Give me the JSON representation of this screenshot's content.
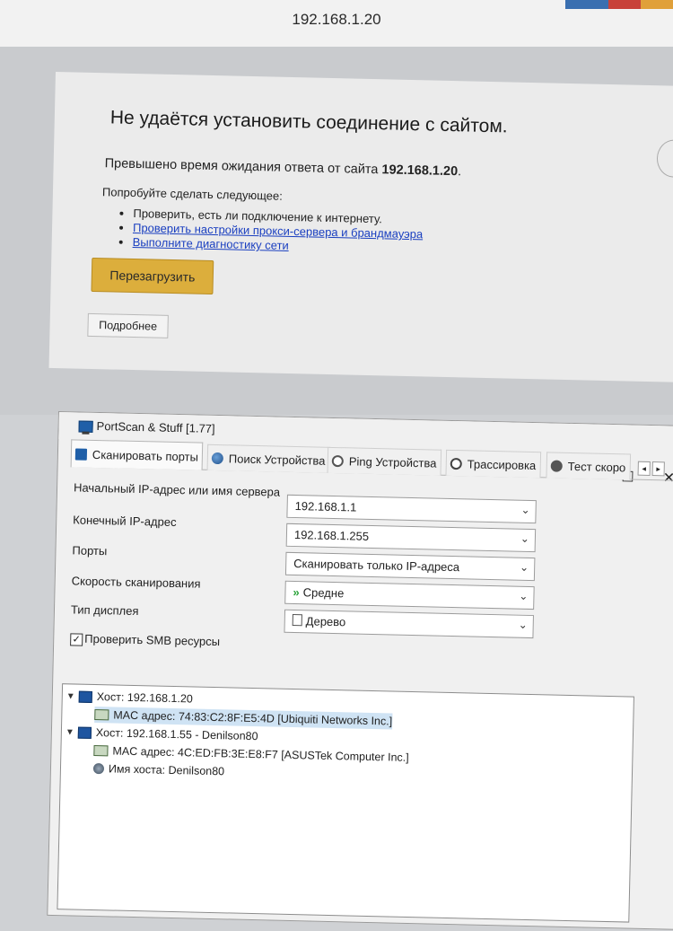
{
  "browser": {
    "url": "192.168.1.20"
  },
  "error_page": {
    "title": "Не удаётся установить соединение с сайтом.",
    "desc_prefix": "Превышено время ожидания ответа от сайта ",
    "desc_host": "192.168.1.20",
    "desc_suffix": ".",
    "try_text": "Попробуйте сделать следующее:",
    "suggestions": [
      "Проверить, есть ли подключение к интернету.",
      "Проверить настройки прокси-сервера и брандмауэра",
      "Выполните диагностику сети"
    ],
    "reload_label": "Перезагрузить",
    "details_label": "Подробнее"
  },
  "app": {
    "title": "PortScan & Stuff [1.77]",
    "minimize": "—",
    "maximize": "☐",
    "close": "✕",
    "tabs": [
      {
        "label": "Сканировать порты",
        "icon": "monitor-icon"
      },
      {
        "label": "Поиск Устройства",
        "icon": "globe-icon"
      },
      {
        "label": "Ping Устройства",
        "icon": "ping-icon"
      },
      {
        "label": "Трассировка",
        "icon": "trace-icon"
      },
      {
        "label": "Тест скоро",
        "icon": "speedtest-icon"
      }
    ],
    "tab_scroll_left": "◂",
    "tab_scroll_right": "▸",
    "form": {
      "start_ip_label": "Начальный IP-адрес или имя сервера",
      "start_ip_value": "192.168.1.1",
      "end_ip_label": "Конечный IP-адрес",
      "end_ip_value": "192.168.1.255",
      "ports_label": "Порты",
      "ports_value": "Сканировать только IP-адреса",
      "speed_label": "Скорость сканирования",
      "speed_value": "Средне",
      "display_label": "Тип дисплея",
      "display_value": "Дерево",
      "smb_label": "Проверить SMB ресурсы",
      "smb_checked": true
    },
    "tree": [
      {
        "text": "Хост: 192.168.1.20",
        "level": 0,
        "kind": "host",
        "expanded": true,
        "selected": false
      },
      {
        "text": "MAC адрес: 74:83:C2:8F:E5:4D [Ubiquiti Networks Inc.]",
        "level": 1,
        "kind": "mac",
        "selected": true
      },
      {
        "text": "Хост: 192.168.1.55 - Denilson80",
        "level": 0,
        "kind": "host",
        "expanded": true,
        "selected": false
      },
      {
        "text": "MAC адрес: 4C:ED:FB:3E:E8:F7 [ASUSTek Computer Inc.]",
        "level": 1,
        "kind": "mac",
        "selected": false
      },
      {
        "text": "Имя хоста: Denilson80",
        "level": 1,
        "kind": "hostname",
        "selected": false
      }
    ]
  }
}
